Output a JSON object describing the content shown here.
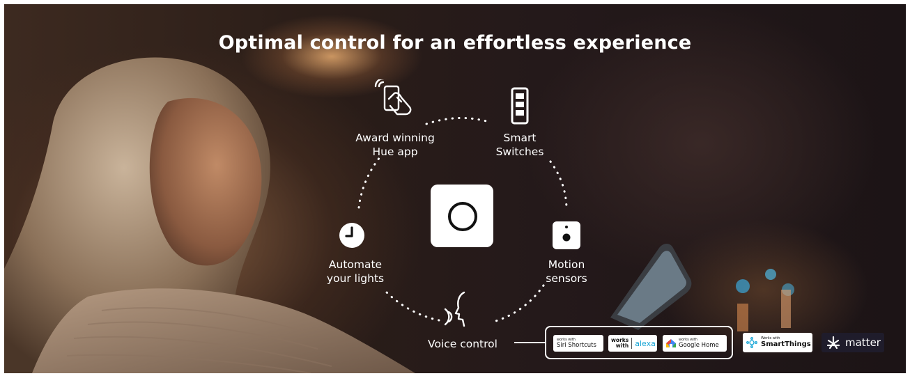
{
  "headline": "Optimal control for an effortless experience",
  "features": [
    {
      "label": "Award winning\nHue app",
      "icon": "phone-app-icon"
    },
    {
      "label": "Smart\nSwitches",
      "icon": "smart-switch-icon"
    },
    {
      "label": "Motion\nsensors",
      "icon": "motion-sensor-icon"
    },
    {
      "label": "Voice control",
      "icon": "voice-control-icon"
    },
    {
      "label": "Automate\nyour lights",
      "icon": "clock-icon"
    }
  ],
  "center_icon": "hue-bridge-icon",
  "compatibility": {
    "siri": {
      "small": "works with",
      "big": "Siri Shortcuts"
    },
    "alexa": {
      "works": "works",
      "with": "with",
      "brand": "alexa"
    },
    "google": {
      "small": "works with",
      "big": "Google Home"
    },
    "smartthings": {
      "small": "Works with",
      "big": "SmartThings"
    },
    "matter": {
      "label": "matter"
    }
  },
  "colors": {
    "text": "#ffffff",
    "accent_alexa": "#1aa6d6",
    "badge_bg": "#ffffff",
    "matter_bg": "#1f1c2b"
  }
}
